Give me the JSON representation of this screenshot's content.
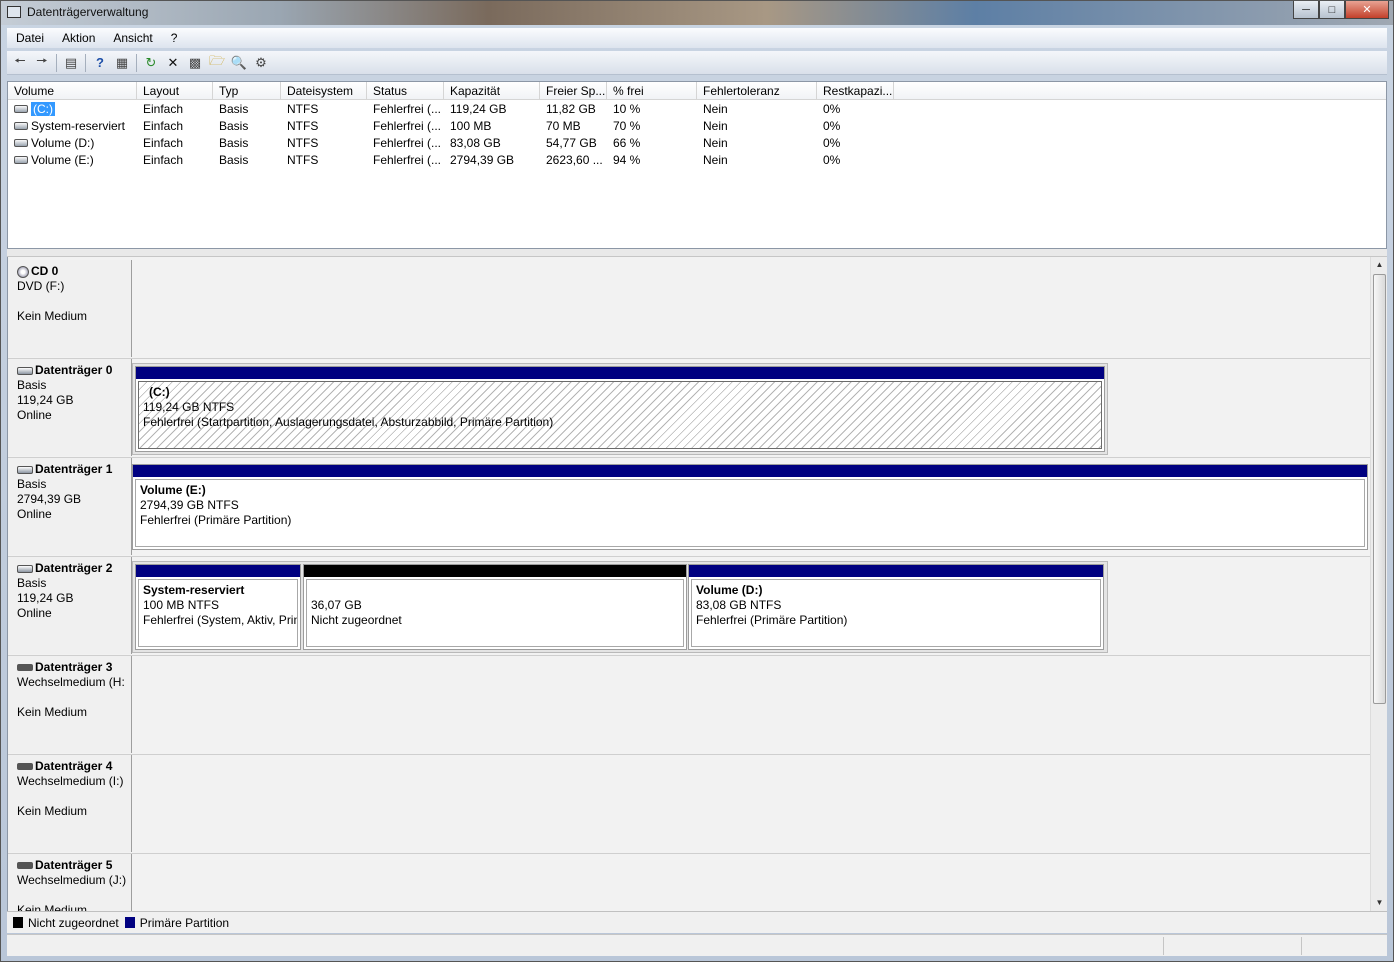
{
  "window": {
    "title": "Datenträgerverwaltung"
  },
  "menu": [
    "Datei",
    "Aktion",
    "Ansicht",
    "?"
  ],
  "toolbar": [
    "back-icon",
    "forward-icon",
    "console-tree-icon",
    "help-icon",
    "view-icon",
    "refresh-icon",
    "delete-icon",
    "properties-icon",
    "open-icon",
    "rescan-icon",
    "settings-icon"
  ],
  "volume_list": {
    "columns": [
      "Volume",
      "Layout",
      "Typ",
      "Dateisystem",
      "Status",
      "Kapazität",
      "Freier Sp...",
      "% frei",
      "Fehlertoleranz",
      "Restkapazi..."
    ],
    "rows": [
      [
        "(C:)",
        "Einfach",
        "Basis",
        "NTFS",
        "Fehlerfrei (...",
        "119,24 GB",
        "11,82 GB",
        "10 %",
        "Nein",
        "0%"
      ],
      [
        "System-reserviert",
        "Einfach",
        "Basis",
        "NTFS",
        "Fehlerfrei (...",
        "100 MB",
        "70 MB",
        "70 %",
        "Nein",
        "0%"
      ],
      [
        "Volume (D:)",
        "Einfach",
        "Basis",
        "NTFS",
        "Fehlerfrei (...",
        "83,08 GB",
        "54,77 GB",
        "66 %",
        "Nein",
        "0%"
      ],
      [
        "Volume (E:)",
        "Einfach",
        "Basis",
        "NTFS",
        "Fehlerfrei (...",
        "2794,39 GB",
        "2623,60 ...",
        "94 %",
        "Nein",
        "0%"
      ]
    ]
  },
  "disks": [
    {
      "name": "CD 0",
      "line1": "DVD (F:)",
      "line2": "",
      "line3": "Kein Medium"
    },
    {
      "name": "Datenträger 0",
      "line1": "Basis",
      "line2": "119,24 GB",
      "line3": "Online",
      "partitions": [
        {
          "name": "(C:)",
          "size": "119,24 GB NTFS",
          "status": "Fehlerfrei (Startpartition, Auslagerungsdatei, Absturzabbild, Primäre Partition)"
        }
      ]
    },
    {
      "name": "Datenträger 1",
      "line1": "Basis",
      "line2": "2794,39 GB",
      "line3": "Online",
      "partitions": [
        {
          "name": "Volume  (E:)",
          "size": "2794,39 GB NTFS",
          "status": "Fehlerfrei (Primäre Partition)"
        }
      ]
    },
    {
      "name": "Datenträger 2",
      "line1": "Basis",
      "line2": "119,24 GB",
      "line3": "Online",
      "partitions": [
        {
          "name": "System-reserviert",
          "size": "100 MB NTFS",
          "status": "Fehlerfrei (System, Aktiv, Prin"
        },
        {
          "name": "",
          "size": "36,07 GB",
          "status": "Nicht zugeordnet"
        },
        {
          "name": "Volume  (D:)",
          "size": "83,08 GB NTFS",
          "status": "Fehlerfrei (Primäre Partition)"
        }
      ]
    },
    {
      "name": "Datenträger 3",
      "line1": "Wechselmedium (H:",
      "line2": "",
      "line3": "Kein Medium"
    },
    {
      "name": "Datenträger 4",
      "line1": "Wechselmedium (I:)",
      "line2": "",
      "line3": "Kein Medium"
    },
    {
      "name": "Datenträger 5",
      "line1": "Wechselmedium (J:)",
      "line2": "",
      "line3": "Kein Medium"
    }
  ],
  "legend": {
    "unallocated": "Nicht zugeordnet",
    "primary": "Primäre Partition",
    "unallocated_color": "#000000",
    "primary_color": "#000080"
  }
}
